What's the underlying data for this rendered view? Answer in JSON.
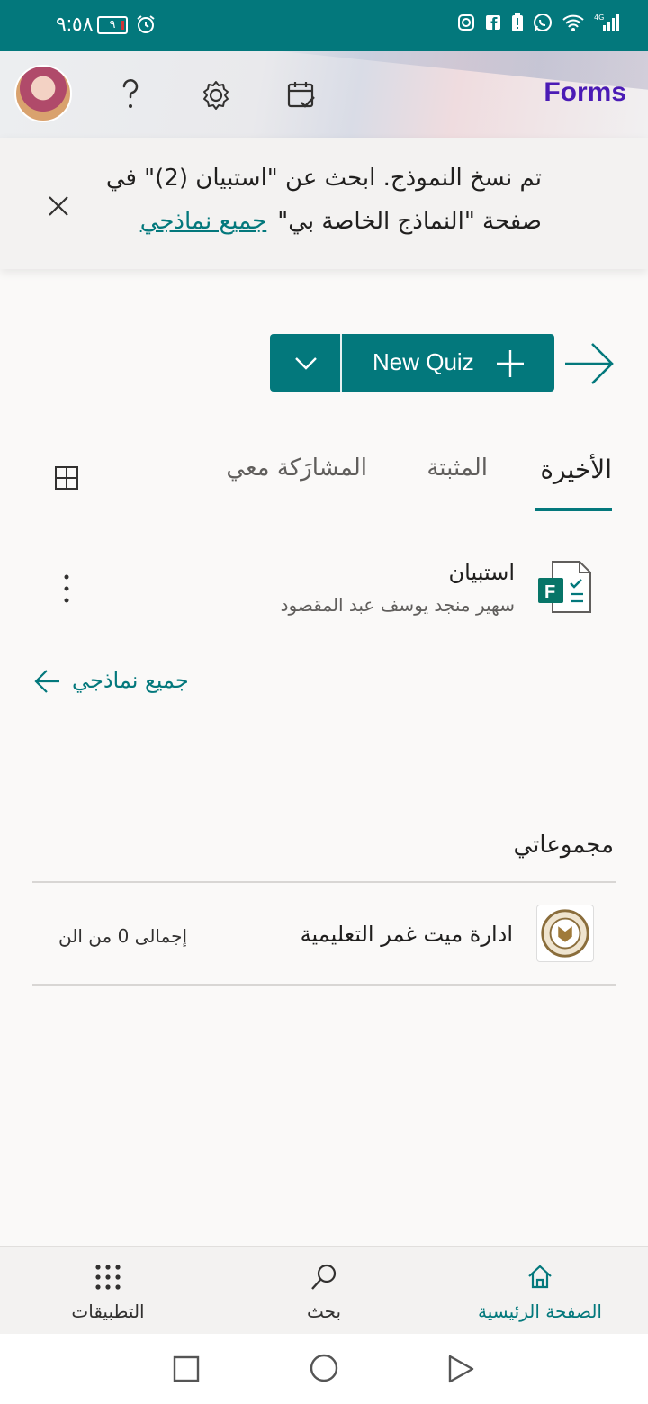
{
  "status_bar": {
    "time": "٩:٥٨",
    "battery": "٩"
  },
  "header": {
    "app_title": "Forms"
  },
  "notice": {
    "line1": "تم نسخ النموذج. ابحث عن \"استبيان (2)\" في",
    "line2": "صفحة \"النماذج الخاصة بي\"",
    "link": "جميع نماذجي"
  },
  "toolbar": {
    "new_quiz_label": "New Quiz"
  },
  "tabs": [
    {
      "label": "الأخيرة",
      "active": true
    },
    {
      "label": "المثبتة",
      "active": false
    },
    {
      "label": "المشارَكة معي",
      "active": false
    }
  ],
  "recent_forms": [
    {
      "name": "استبيان",
      "owner": "سهير منجد يوسف عبد المقصود"
    }
  ],
  "all_forms_link": "جميع نماذجي",
  "groups": {
    "title": "مجموعاتي",
    "items": [
      {
        "name": "ادارة ميت غمر التعليمية",
        "total": "إجمالى 0 من الن"
      }
    ]
  },
  "bottom_nav": {
    "home": "الصفحة الرئيسية",
    "search": "بحث",
    "apps": "التطبيقات"
  },
  "colors": {
    "accent": "#03787c",
    "brand": "#4b1bb5"
  }
}
